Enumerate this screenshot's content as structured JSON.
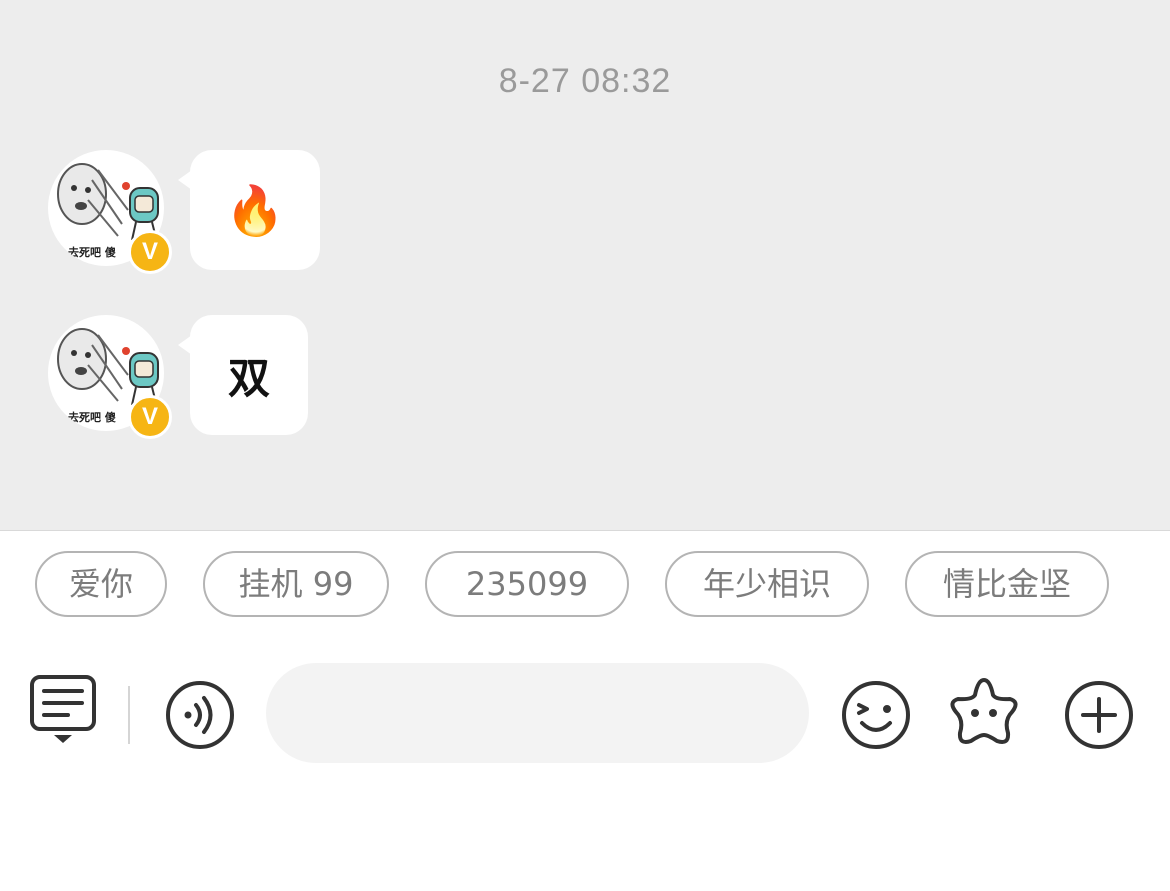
{
  "timestamp": "8-27 08:32",
  "messages": [
    {
      "avatar_caption": "去死吧 傻",
      "badge": "V",
      "content": "🔥"
    },
    {
      "avatar_caption": "去死吧 傻",
      "badge": "V",
      "content": "双"
    }
  ],
  "quick_replies": [
    "爱你",
    "挂机 99",
    "235099",
    "年少相识",
    "情比金坚"
  ],
  "input": {
    "placeholder": "",
    "value": ""
  },
  "toolbar_icons": [
    "keyboard-menu-icon",
    "voice-icon",
    "emoji-icon",
    "star-sticker-icon",
    "plus-icon"
  ],
  "colors": {
    "chat_bg": "#ededed",
    "vip_badge": "#f6b514",
    "chip_border": "#b4b4b4"
  }
}
